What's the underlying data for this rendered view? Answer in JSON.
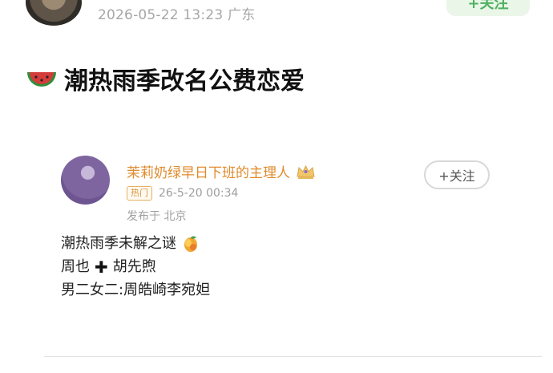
{
  "header": {
    "timestamp_location": "2026-05-22 13:23  广东",
    "follow_label": "+关注"
  },
  "post": {
    "title": "潮热雨季改名公费恋爱"
  },
  "shared_card": {
    "author_name": "茉莉奶绿早日下班的主理人",
    "badge": "热门",
    "date_time": "26-5-20 00:34",
    "location": "发布于 北京",
    "follow_label": "+关注",
    "lines": [
      "潮热雨季未解之谜",
      "周也",
      "胡先煦",
      "男二女二:周皓崎李宛妲"
    ]
  },
  "icons": {
    "title_emoji": "watermelon-icon",
    "line_emoji": "mango-icon",
    "plus_icon": "heavy-plus-icon",
    "crown_icon": "crown-icon"
  },
  "colors": {
    "follow_green": "#4fb061",
    "author_orange": "#e18a2d",
    "meta_gray": "#9e9e9e"
  }
}
